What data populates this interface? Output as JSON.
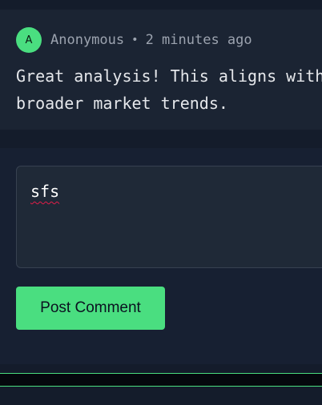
{
  "comment": {
    "avatar_initial": "A",
    "author": "Anonymous",
    "separator": "•",
    "time": "2 minutes ago",
    "text_line1": "Great analysis! This aligns with",
    "text_line2": "broader market trends."
  },
  "composer": {
    "value": "sfs",
    "button_label": "Post Comment"
  },
  "colors": {
    "accent": "#4ade80",
    "background": "#141c2b",
    "card": "#1b2433"
  }
}
